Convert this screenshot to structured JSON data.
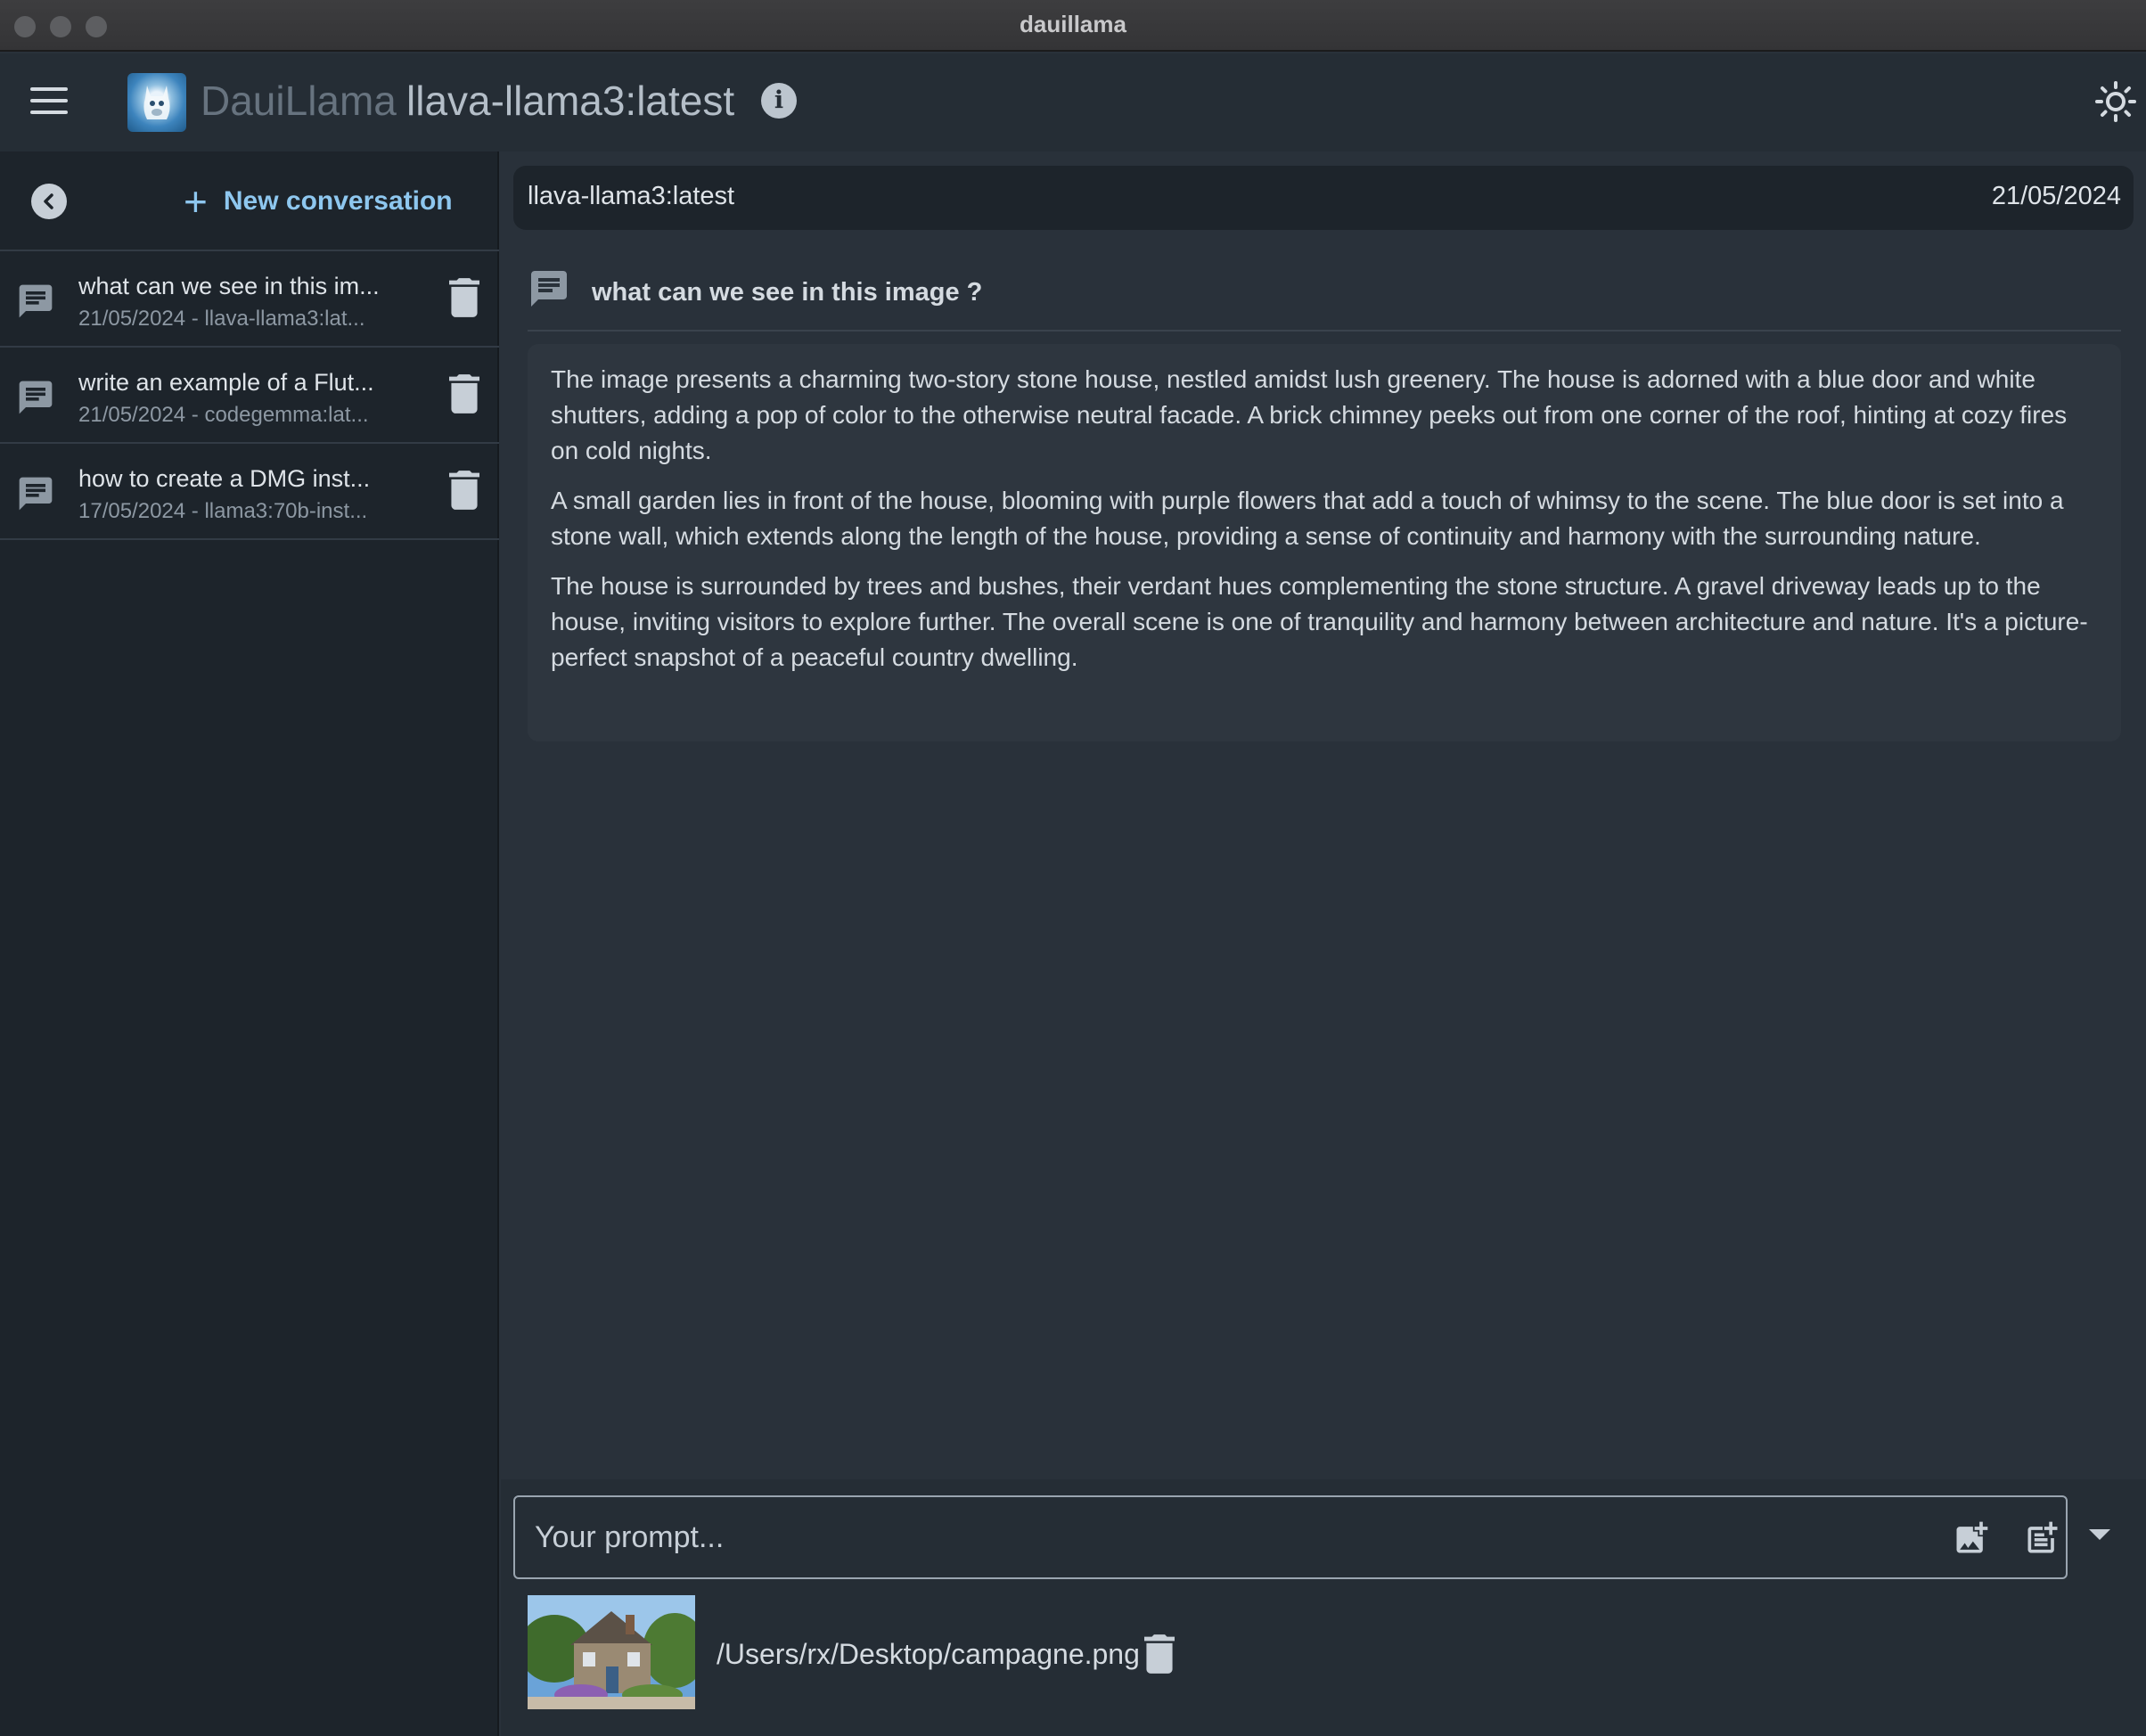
{
  "window": {
    "title": "dauillama"
  },
  "appbar": {
    "menu_icon": "hamburger-menu-icon",
    "app_name": "DauiLlama",
    "model_name": "llava-llama3:latest",
    "info_icon": "info-icon",
    "theme_icon": "brightness-icon"
  },
  "sidebar": {
    "new_conversation_label": "New conversation",
    "conversations": [
      {
        "title": "what can we see in this im...",
        "subtitle": "21/05/2024 - llava-llama3:lat..."
      },
      {
        "title": "write an example of a Flut...",
        "subtitle": "21/05/2024 - codegemma:lat..."
      },
      {
        "title": "how to create a DMG inst...",
        "subtitle": "17/05/2024 - llama3:70b-inst..."
      }
    ]
  },
  "conversation": {
    "model": "llava-llama3:latest",
    "date": "21/05/2024",
    "question": "what can we see in this image ?",
    "answer": [
      "The image presents a charming two-story stone house, nestled amidst lush greenery. The house is adorned with a blue door and white shutters, adding a pop of color to the otherwise neutral facade. A brick chimney peeks out from one corner of the roof, hinting at cozy fires on cold nights.",
      "A small garden lies in front of the house, blooming with purple flowers that add a touch of whimsy to the scene. The blue door is set into a stone wall, which extends along the length of the house, providing a sense of continuity and harmony with the surrounding nature.",
      "The house is surrounded by trees and bushes, their verdant hues complementing the stone structure. A gravel driveway leads up to the house, inviting visitors to explore further. The overall scene is one of tranquility and harmony between architecture and nature. It's a picture-perfect snapshot of a peaceful country dwelling."
    ]
  },
  "prompt": {
    "placeholder": "Your prompt...",
    "value": ""
  },
  "attachment": {
    "path": "/Users/rx/Desktop/campagne.png"
  },
  "colors": {
    "accent": "#8ec7ef",
    "background": "#29313a",
    "sidebar": "#1d242b"
  }
}
